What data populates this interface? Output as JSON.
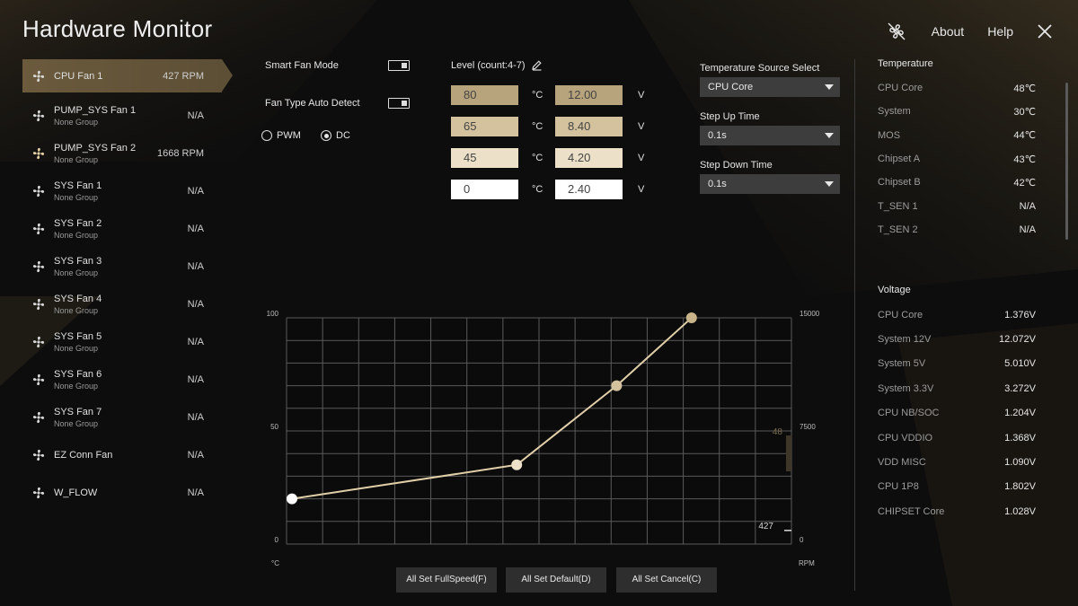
{
  "app": {
    "title": "Hardware Monitor",
    "topbar": {
      "about": "About",
      "help": "Help",
      "icon_fan_off": "fan-off-icon",
      "icon_close": "close-icon"
    }
  },
  "fans": [
    {
      "name": "CPU Fan 1",
      "group": "",
      "speed": "427 RPM",
      "selected": true
    },
    {
      "name": "PUMP_SYS Fan 1",
      "group": "None Group",
      "speed": "N/A"
    },
    {
      "name": "PUMP_SYS Fan 2",
      "group": "None Group",
      "speed": "1668 RPM"
    },
    {
      "name": "SYS Fan 1",
      "group": "None Group",
      "speed": "N/A"
    },
    {
      "name": "SYS Fan 2",
      "group": "None Group",
      "speed": "N/A"
    },
    {
      "name": "SYS Fan 3",
      "group": "None Group",
      "speed": "N/A"
    },
    {
      "name": "SYS Fan 4",
      "group": "None Group",
      "speed": "N/A"
    },
    {
      "name": "SYS Fan 5",
      "group": "None Group",
      "speed": "N/A"
    },
    {
      "name": "SYS Fan 6",
      "group": "None Group",
      "speed": "N/A"
    },
    {
      "name": "SYS Fan 7",
      "group": "None Group",
      "speed": "N/A"
    },
    {
      "name": "EZ Conn Fan",
      "group": "",
      "speed": "N/A"
    },
    {
      "name": "W_FLOW",
      "group": "",
      "speed": "N/A"
    }
  ],
  "controls": {
    "smart_fan_mode": "Smart Fan Mode",
    "fan_type_auto_detect": "Fan Type Auto Detect",
    "pwm": "PWM",
    "dc": "DC",
    "level_label": "Level (count:4-7)",
    "temp_unit": "°C",
    "volt_unit": "V",
    "levels": [
      {
        "temp": "80",
        "volt": "12.00"
      },
      {
        "temp": "65",
        "volt": "8.40"
      },
      {
        "temp": "45",
        "volt": "4.20"
      },
      {
        "temp": "0",
        "volt": "2.40"
      }
    ],
    "temp_source_label": "Temperature Source Select",
    "temp_source_value": "CPU Core",
    "step_up_label": "Step Up Time",
    "step_up_value": "0.1s",
    "step_down_label": "Step Down Time",
    "step_down_value": "0.1s"
  },
  "temperature": {
    "header": "Temperature",
    "rows": [
      {
        "k": "CPU Core",
        "v": "48℃"
      },
      {
        "k": "System",
        "v": "30℃"
      },
      {
        "k": "MOS",
        "v": "44℃"
      },
      {
        "k": "Chipset A",
        "v": "43℃"
      },
      {
        "k": "Chipset B",
        "v": "42℃"
      },
      {
        "k": "T_SEN 1",
        "v": "N/A"
      },
      {
        "k": "T_SEN 2",
        "v": "N/A"
      }
    ]
  },
  "voltage": {
    "header": "Voltage",
    "rows": [
      {
        "k": "CPU Core",
        "v": "1.376V"
      },
      {
        "k": "System 12V",
        "v": "12.072V"
      },
      {
        "k": "System 5V",
        "v": "5.010V"
      },
      {
        "k": "System 3.3V",
        "v": "3.272V"
      },
      {
        "k": "CPU NB/SOC",
        "v": "1.204V"
      },
      {
        "k": "CPU VDDIO",
        "v": "1.368V"
      },
      {
        "k": "VDD MISC",
        "v": "1.090V"
      },
      {
        "k": "CPU 1P8",
        "v": "1.802V"
      },
      {
        "k": "CHIPSET Core",
        "v": "1.028V"
      }
    ]
  },
  "chart_data": {
    "type": "line",
    "x_unit_label": "°C",
    "y2_unit_label": "RPM",
    "ylim": [
      0,
      100
    ],
    "y2lim": [
      0,
      15000
    ],
    "y_ticks": [
      "100",
      "50",
      "0"
    ],
    "y2_ticks": [
      "15000",
      "7500",
      "0"
    ],
    "grid": true,
    "points": [
      {
        "x": 0,
        "y": 20
      },
      {
        "x": 45,
        "y": 35
      },
      {
        "x": 65,
        "y": 70
      },
      {
        "x": 80,
        "y": 100
      }
    ],
    "current_temp_marker": "48",
    "current_rpm_marker": "427",
    "curve_color": "#e0cfa8",
    "accent_color": "#c9b48a"
  },
  "buttons": {
    "full_speed": "All Set FullSpeed(F)",
    "default": "All Set Default(D)",
    "cancel": "All Set Cancel(C)"
  }
}
